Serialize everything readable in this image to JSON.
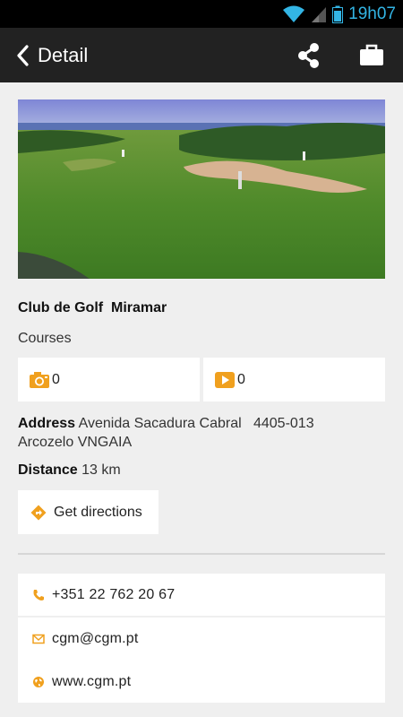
{
  "status_bar": {
    "time": "19h07"
  },
  "action_bar": {
    "title": "Detail",
    "icons": [
      "back-chevron-icon",
      "share-icon",
      "briefcase-icon"
    ]
  },
  "club": {
    "name": "Club de Golf  Miramar",
    "category": "Courses",
    "photos_count": "0",
    "videos_count": "0",
    "address_label": "Address",
    "address_line1": "Avenida Sacadura Cabral   4405-013",
    "address_line2": "Arcozelo VNGAIA",
    "distance_label": "Distance",
    "distance_value": "13 km",
    "directions_label": "Get directions"
  },
  "contact": {
    "phone": "+351 22 762 20 67",
    "email": "cgm@cgm.pt",
    "website": "www.cgm.pt"
  },
  "colors": {
    "accent": "#f0a01e",
    "status_blue": "#33b5e5",
    "actionbar": "#222222",
    "background": "#efefef"
  }
}
